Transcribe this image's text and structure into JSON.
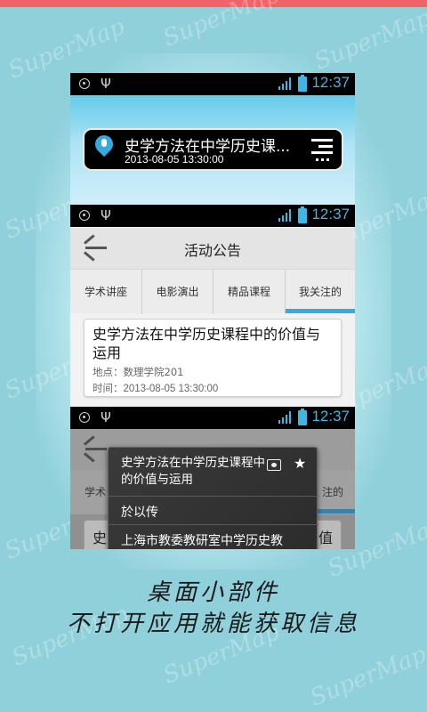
{
  "watermark_text": "SuperMap",
  "status_bar": {
    "clock": "12:37"
  },
  "widget": {
    "title": "史学方法在中学历史课...",
    "time": "2013-08-05 13:30:00",
    "icon": "microphone-location-icon",
    "menu_icon": "menu-lines-icon"
  },
  "app": {
    "title": "活动公告",
    "tabs": [
      {
        "label": "学术讲座"
      },
      {
        "label": "电影演出"
      },
      {
        "label": "精品课程"
      },
      {
        "label": "我关注的"
      }
    ],
    "active_tab": "我关注的",
    "card": {
      "title": "史学方法在中学历史课程中的价值与运用",
      "location": "地点：数理学院201",
      "time": "时间：2013-08-05 13:30:00"
    }
  },
  "popup": {
    "title": "史学方法在中学历史课程中的价值与运用",
    "speaker": "於以传",
    "organization": "上海市教委教研室中学历史教",
    "behind_tab_left": "学术",
    "behind_tab_right": "注的",
    "behind_card_left": "史",
    "behind_card_right": "值"
  },
  "caption": {
    "line1": "桌面小部件",
    "line2": "不打开应用就能获取信息"
  },
  "colors": {
    "background": "#8fd0da",
    "accent_blue": "#3aa8e0",
    "top_strip": "#f0636a"
  }
}
